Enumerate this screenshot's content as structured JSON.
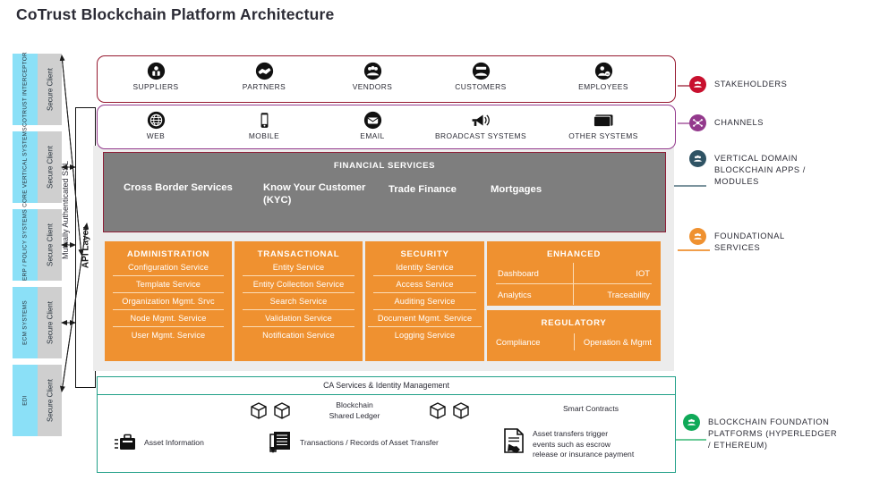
{
  "page": {
    "title": "CoTrust Blockchain Platform Architecture"
  },
  "colors": {
    "stakeholders": "#96182F",
    "channels": "#93398C",
    "vertical_domain": "#2F5364",
    "foundational": "#EF9130",
    "blockchain_foundation": "#0FA958",
    "orange": "#EF9130",
    "grey_block": "#7E7E7E",
    "backdrop": "#ECECEC",
    "secure_client": "#CFCFCF",
    "system_blue": "#8BE0F7"
  },
  "sidebar": {
    "secure_client_label": "Secure Client",
    "systems": [
      {
        "name": "COTRUST\nINTERCEPTOR"
      },
      {
        "name": "CORE VERTICAL\nSYSTEMS"
      },
      {
        "name": "ERP / POLICY\nSYSTEMS"
      },
      {
        "name": "ECM SYSTEMS"
      },
      {
        "name": "EDI"
      }
    ]
  },
  "api_layer": {
    "label": "API Layer",
    "ssl_label": "Mutually Authenticated SSL"
  },
  "stakeholders": {
    "items": [
      {
        "label": "SUPPLIERS",
        "icon": "supplier-icon"
      },
      {
        "label": "PARTNERS",
        "icon": "handshake-icon"
      },
      {
        "label": "VENDORS",
        "icon": "vendor-icon"
      },
      {
        "label": "CUSTOMERS",
        "icon": "customers-icon"
      },
      {
        "label": "EMPLOYEES",
        "icon": "employee-icon"
      }
    ]
  },
  "channels": {
    "items": [
      {
        "label": "WEB",
        "icon": "globe-icon"
      },
      {
        "label": "MOBILE",
        "icon": "phone-icon"
      },
      {
        "label": "EMAIL",
        "icon": "envelope-icon"
      },
      {
        "label": "BROADCAST SYSTEMS",
        "icon": "megaphone-icon"
      },
      {
        "label": "OTHER SYSTEMS",
        "icon": "monitor-icon"
      }
    ]
  },
  "financial_services": {
    "title": "FINANCIAL SERVICES",
    "items": [
      "Cross Border Services",
      "Know Your Customer (KYC)",
      "Trade Finance",
      "Mortgages"
    ]
  },
  "foundational_columns": [
    {
      "title": "ADMINISTRATION",
      "services": [
        "Configuration Service",
        "Template Service",
        "Organization Mgmt. Srvc",
        "Node Mgmt. Service",
        "User Mgmt. Service"
      ]
    },
    {
      "title": "TRANSACTIONAL",
      "services": [
        "Entity Service",
        "Entity Collection Service",
        "Search Service",
        "Validation Service",
        "Notification Service"
      ]
    },
    {
      "title": "SECURITY",
      "services": [
        "Identity Service",
        "Access Service",
        "Auditing Service",
        "Document Mgmt. Service",
        "Logging Service"
      ]
    }
  ],
  "enhanced": {
    "title": "ENHANCED",
    "cells": [
      "Dashboard",
      "IOT",
      "Analytics",
      "Traceability"
    ]
  },
  "regulatory": {
    "title": "REGULATORY",
    "cells": [
      "Compliance",
      "Operation & Mgmt"
    ]
  },
  "blockchain_foundation": {
    "ca_bar": "CA Services & Identity Management",
    "shared_ledger": "Blockchain\nShared Ledger",
    "smart_contracts": "Smart Contracts",
    "asset_information": "Asset Information",
    "transactions": "Transactions / Records of Asset Transfer",
    "asset_transfers": "Asset transfers trigger\nevents such as escrow\nrelease or insurance payment"
  },
  "legend": [
    {
      "label": "STAKEHOLDERS",
      "color": "#C8102E",
      "icon": "stakeholders-icon"
    },
    {
      "label": "CHANNELS",
      "color": "#93398C",
      "icon": "channels-icon"
    },
    {
      "label": "VERTICAL DOMAIN\nBLOCKCHAIN APPS /\nMODULES",
      "color": "#2F5364",
      "icon": "vertical-domain-icon"
    },
    {
      "label": "FOUNDATIONAL\nSERVICES",
      "color": "#EF9130",
      "icon": "foundational-icon"
    },
    {
      "label": "BLOCKCHAIN FOUNDATION\nPLATFORMS (HYPERLEDGER\n/ ETHEREUM)",
      "color": "#0FA958",
      "icon": "blockchain-foundation-icon"
    }
  ]
}
